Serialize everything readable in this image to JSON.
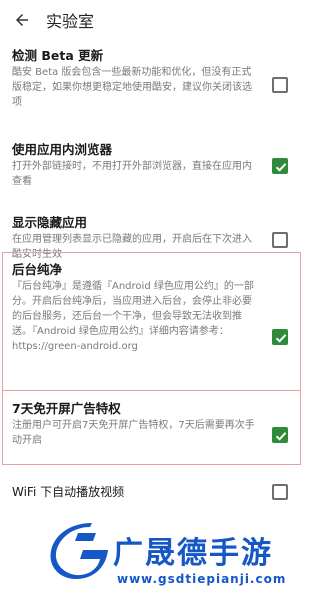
{
  "header": {
    "title": "实验室"
  },
  "settings": [
    {
      "title": "检测 Beta 更新",
      "desc": "酷安 Beta 版会包含一些最新功能和优化，但没有正式版稳定，如果你想更稳定地使用酷安，建议你关闭该选项",
      "checked": false
    },
    {
      "title": "使用应用内浏览器",
      "desc": "打开外部链接时，不用打开外部浏览器，直接在应用内查看",
      "checked": true
    },
    {
      "title": "显示隐藏应用",
      "desc": "在应用管理列表显示已隐藏的应用，开启后在下次进入酷安时生效",
      "checked": false
    },
    {
      "title": "后台纯净",
      "desc": "『后台纯净』是遵循『Android 绿色应用公约』的一部分。开启后台纯净后，当应用进入后台，会停止非必要的后台服务，还后台一个干净，但会导致无法收到推送。『Android 绿色应用公约』详细内容请参考：https://green-android.org",
      "checked": true
    },
    {
      "title": "7天免开屏广告特权",
      "desc": "注册用户可开启7天免开屏广告特权，7天后需要再次手动开启",
      "checked": true
    },
    {
      "title": "WiFi 下自动播放视频",
      "checked": false
    }
  ],
  "watermark": {
    "title": "广晟德手游",
    "url": "www.gsdtiepianji.com"
  },
  "colors": {
    "accent": "#2e8b3a",
    "highlight": "#e8a0a0",
    "watermark": "#1557c6"
  }
}
